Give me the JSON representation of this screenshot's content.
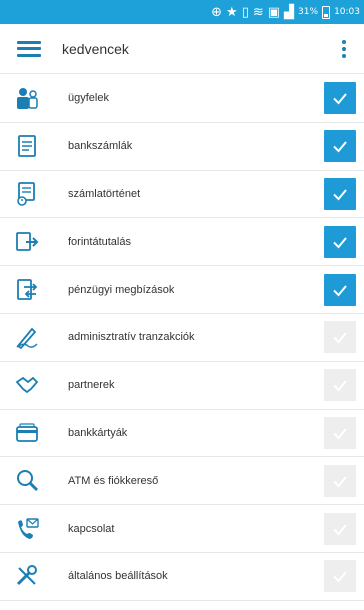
{
  "status_bar": {
    "battery": "31%",
    "time": "10:03",
    "color": "#1ea1d8"
  },
  "header": {
    "title": "kedvencek",
    "menu_icon": "hamburger-menu-icon",
    "overflow_icon": "more-vert-icon"
  },
  "colors": {
    "accent": "#1b7fb3",
    "checked": "#1e9ad6",
    "unchecked": "#eeeeee"
  },
  "items": [
    {
      "label": "ügyfelek",
      "icon": "clients-icon",
      "checked": true
    },
    {
      "label": "bankszámlák",
      "icon": "bank-accounts-icon",
      "checked": true
    },
    {
      "label": "számlatörténet",
      "icon": "account-history-icon",
      "checked": true
    },
    {
      "label": "forintátutalás",
      "icon": "forint-transfer-icon",
      "checked": true
    },
    {
      "label": "pénzügyi megbízások",
      "icon": "financial-orders-icon",
      "checked": true
    },
    {
      "label": "adminisztratív tranzakciók",
      "icon": "administrative-transactions-icon",
      "checked": false
    },
    {
      "label": "partnerek",
      "icon": "partners-icon",
      "checked": false
    },
    {
      "label": "bankkártyák",
      "icon": "bank-cards-icon",
      "checked": false
    },
    {
      "label": "ATM és fiókkereső",
      "icon": "atm-branch-finder-icon",
      "checked": false
    },
    {
      "label": "kapcsolat",
      "icon": "contact-icon",
      "checked": false
    },
    {
      "label": "általános beállítások",
      "icon": "general-settings-icon",
      "checked": false
    }
  ]
}
